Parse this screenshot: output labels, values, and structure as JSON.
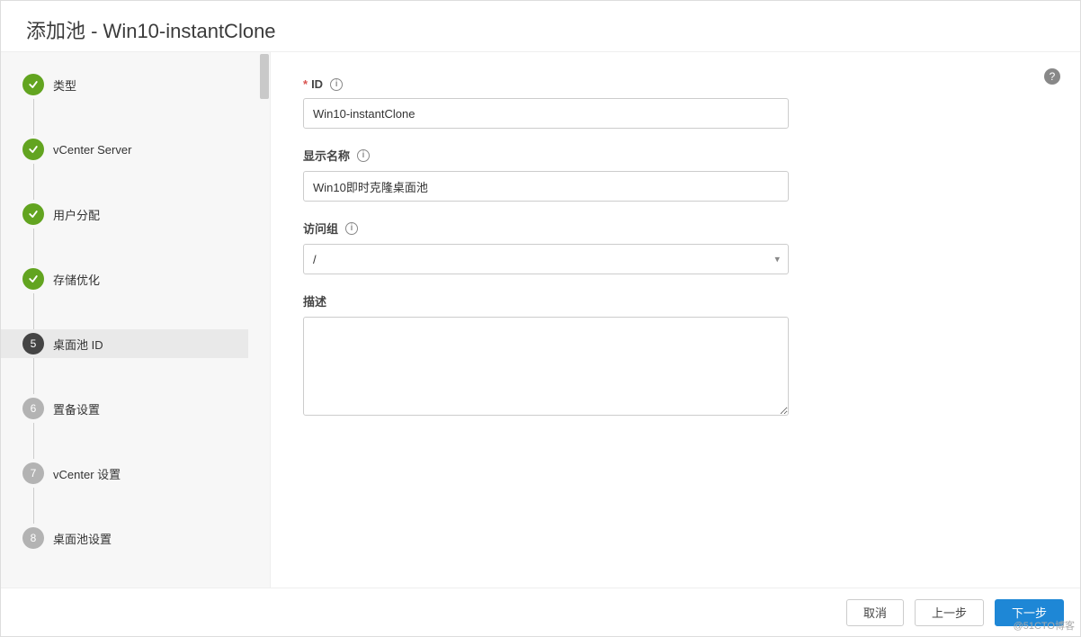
{
  "header": {
    "title": "添加池 - Win10-instantClone"
  },
  "sidebar": {
    "steps": [
      {
        "label": "类型",
        "state": "done"
      },
      {
        "label": "vCenter Server",
        "state": "done"
      },
      {
        "label": "用户分配",
        "state": "done"
      },
      {
        "label": "存储优化",
        "state": "done"
      },
      {
        "label": "桌面池 ID",
        "state": "current",
        "num": "5"
      },
      {
        "label": "置备设置",
        "state": "future",
        "num": "6"
      },
      {
        "label": "vCenter 设置",
        "state": "future",
        "num": "7"
      },
      {
        "label": "桌面池设置",
        "state": "future",
        "num": "8"
      }
    ]
  },
  "form": {
    "id_label": "ID",
    "id_value": "Win10-instantClone",
    "display_label": "显示名称",
    "display_value": "Win10即时克隆桌面池",
    "access_label": "访问组",
    "access_value": "/",
    "desc_label": "描述",
    "desc_value": ""
  },
  "footer": {
    "cancel": "取消",
    "prev": "上一步",
    "next": "下一步"
  },
  "watermark": "@51CTO博客"
}
